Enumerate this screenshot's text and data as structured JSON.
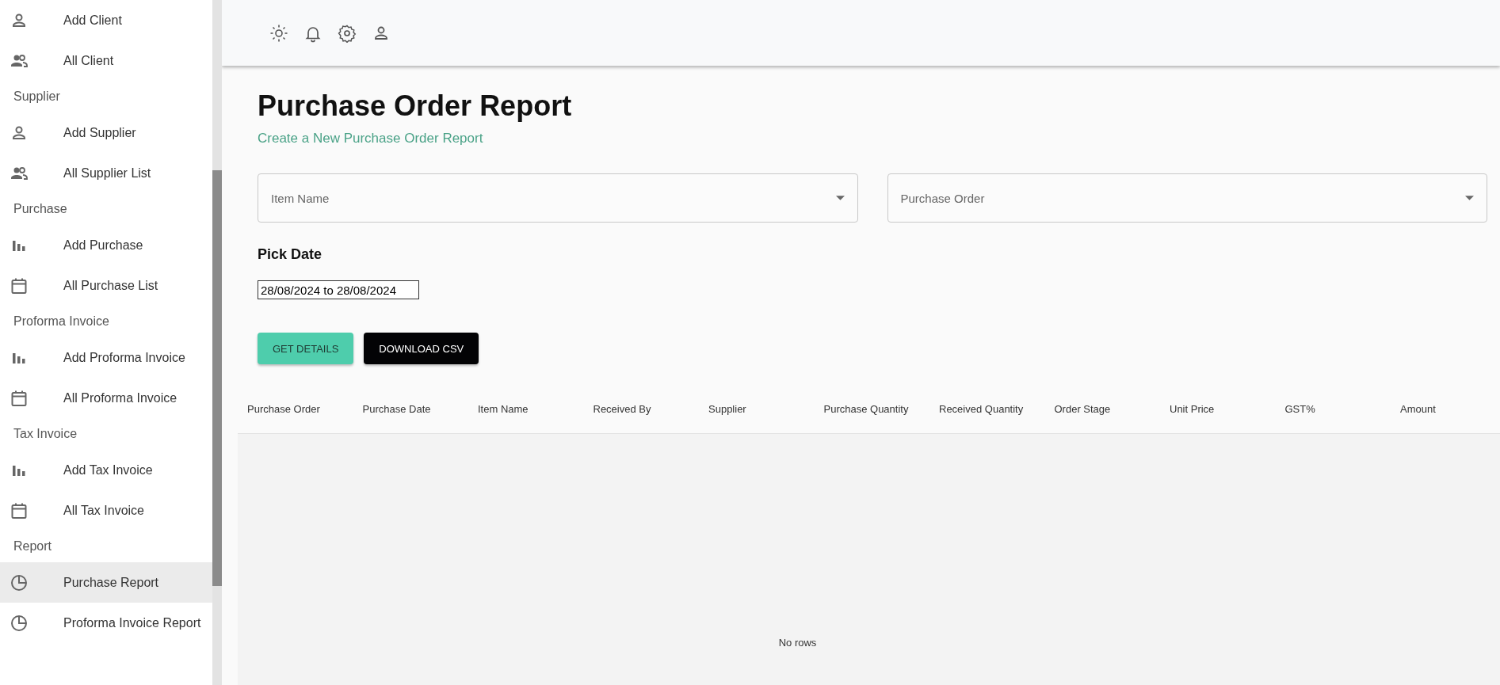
{
  "sidebar": {
    "sections": [
      {
        "items": [
          {
            "label": "Add Client",
            "kind": "add-party",
            "selected": false
          },
          {
            "label": "All Client",
            "kind": "list-party",
            "selected": false
          }
        ]
      },
      {
        "title": "Supplier",
        "items": [
          {
            "label": "Add Supplier",
            "kind": "add-party",
            "selected": false
          },
          {
            "label": "All Supplier List",
            "kind": "list-party",
            "selected": false
          }
        ]
      },
      {
        "title": "Purchase",
        "items": [
          {
            "label": "Add Purchase",
            "kind": "add-doc",
            "selected": false
          },
          {
            "label": "All Purchase List",
            "kind": "list-doc",
            "selected": false
          }
        ]
      },
      {
        "title": "Proforma Invoice",
        "items": [
          {
            "label": "Add Proforma Invoice",
            "kind": "add-doc",
            "selected": false
          },
          {
            "label": "All Proforma Invoice",
            "kind": "list-doc",
            "selected": false
          }
        ]
      },
      {
        "title": "Tax Invoice",
        "items": [
          {
            "label": "Add Tax Invoice",
            "kind": "add-doc",
            "selected": false
          },
          {
            "label": "All Tax Invoice",
            "kind": "list-doc",
            "selected": false
          }
        ]
      },
      {
        "title": "Report",
        "items": [
          {
            "label": "Purchase Report",
            "kind": "report",
            "selected": true
          },
          {
            "label": "Proforma Invoice Report",
            "kind": "report",
            "selected": false
          }
        ]
      }
    ]
  },
  "page": {
    "title": "Purchase Order Report",
    "subtitle": "Create a New Purchase Order Report"
  },
  "filters": [
    {
      "placeholder": "Item Name"
    },
    {
      "placeholder": "Purchase Order"
    }
  ],
  "date": {
    "label": "Pick Date",
    "value": "28/08/2024 to 28/08/2024"
  },
  "buttons": [
    {
      "label": "GET DETAILS",
      "kind": "primary"
    },
    {
      "label": "DOWNLOAD CSV",
      "kind": "dark"
    }
  ],
  "table": {
    "columns": [
      "Purchase Order",
      "Purchase Date",
      "Item Name",
      "Received By",
      "Supplier",
      "Purchase Quantity",
      "Received Quantity",
      "Order Stage",
      "Unit Price",
      "GST%",
      "Amount"
    ],
    "empty_text": "No rows"
  }
}
